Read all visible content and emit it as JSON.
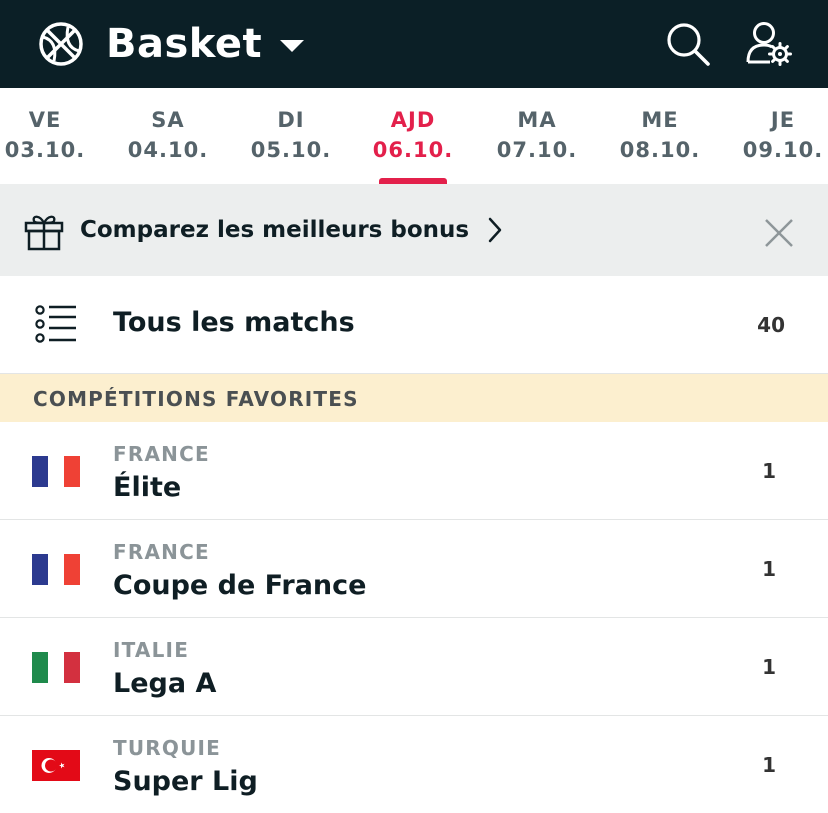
{
  "header": {
    "title": "Basket",
    "sport_icon": "basketball-icon",
    "search_icon": "search-icon",
    "user_icon": "user-settings-icon"
  },
  "dates": [
    {
      "dow": "VE",
      "day": "03.10."
    },
    {
      "dow": "SA",
      "day": "04.10."
    },
    {
      "dow": "DI",
      "day": "05.10."
    },
    {
      "dow": "AJD",
      "day": "06.10.",
      "active": true
    },
    {
      "dow": "MA",
      "day": "07.10."
    },
    {
      "dow": "ME",
      "day": "08.10."
    },
    {
      "dow": "JE",
      "day": "09.10."
    }
  ],
  "bonus": {
    "text": "Comparez les meilleurs bonus",
    "icon": "gift-icon"
  },
  "all_matches": {
    "label": "Tous les matchs",
    "count": "40",
    "icon": "list-icon"
  },
  "favorites": {
    "title": "COMPÉTITIONS FAVORITES",
    "items": [
      {
        "country": "FRANCE",
        "name": "Élite",
        "count": "1",
        "flag": "france-flag-icon"
      },
      {
        "country": "FRANCE",
        "name": "Coupe de France",
        "count": "1",
        "flag": "france-flag-icon"
      },
      {
        "country": "ITALIE",
        "name": "Lega A",
        "count": "1",
        "flag": "italy-flag-icon"
      },
      {
        "country": "TURQUIE",
        "name": "Super Lig",
        "count": "1",
        "flag": "turkey-flag-icon"
      }
    ]
  },
  "colors": {
    "header_bg": "#0b1f26",
    "accent": "#e3204b",
    "banner_bg": "#eceeee",
    "section_bg": "#fcefcf"
  }
}
